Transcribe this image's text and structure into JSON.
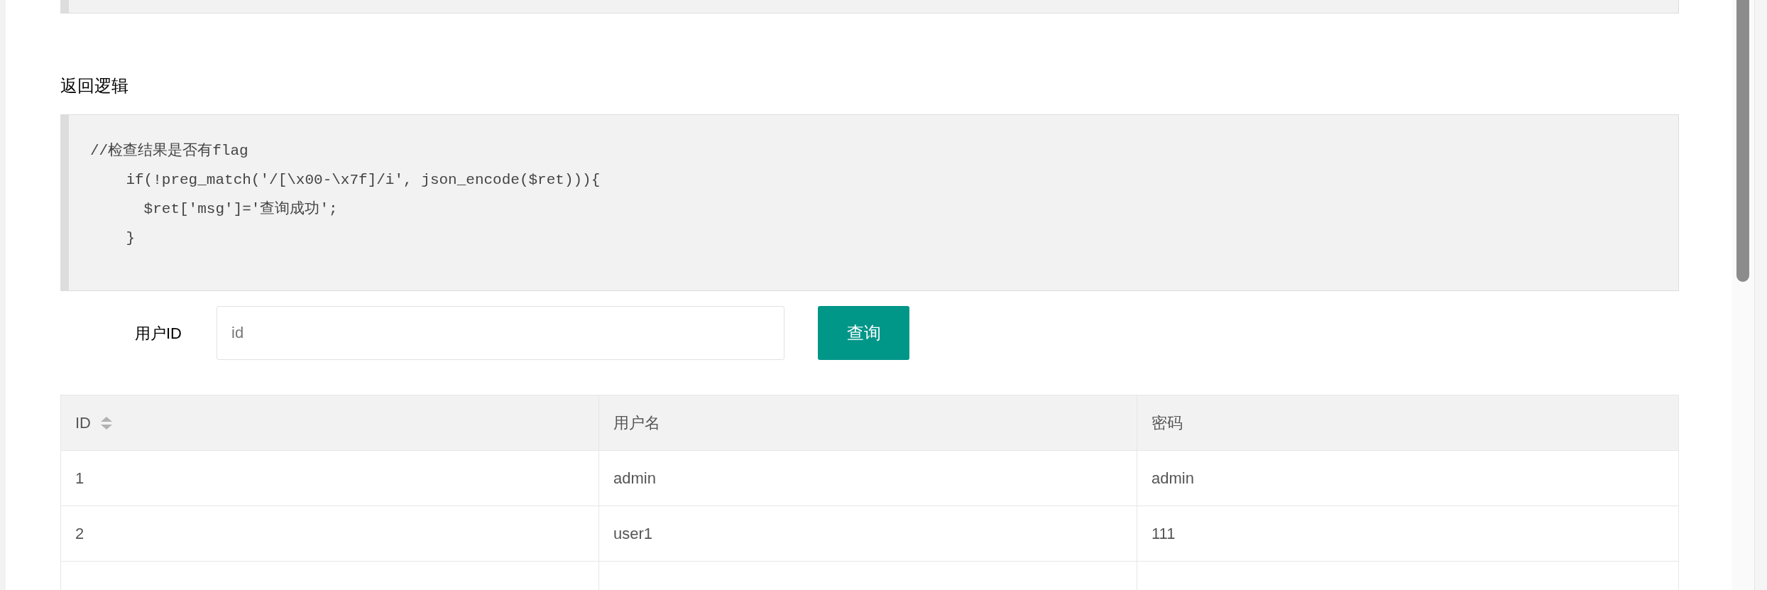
{
  "section_heading": "返回逻辑",
  "code_lines": [
    "//检查结果是否有flag",
    "    if(!preg_match('/[\\x00-\\x7f]/i', json_encode($ret))){",
    "      $ret['msg']='查询成功';",
    "    }"
  ],
  "form": {
    "label": "用户ID",
    "placeholder": "id",
    "button": "查询"
  },
  "table": {
    "columns": [
      {
        "label": "ID",
        "sortable": true
      },
      {
        "label": "用户名",
        "sortable": false
      },
      {
        "label": "密码",
        "sortable": false
      }
    ],
    "rows": [
      [
        "1",
        "admin",
        "admin"
      ],
      [
        "2",
        "user1",
        "111"
      ]
    ]
  }
}
